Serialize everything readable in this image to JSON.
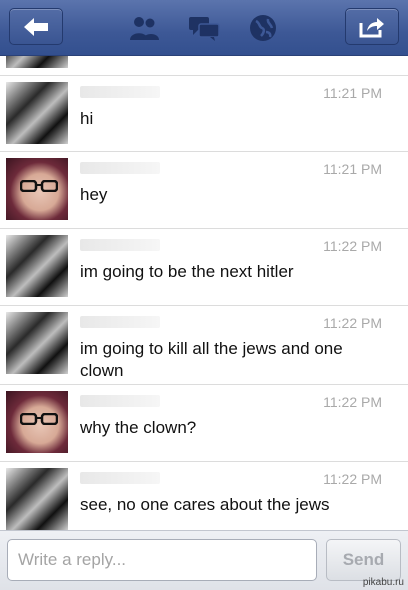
{
  "icons": {
    "back": "arrow-left-icon",
    "friends": "friends-icon",
    "messages": "messages-icon",
    "notifications": "globe-icon",
    "share": "share-icon"
  },
  "messages": [
    {
      "avatar": "dark",
      "time": "",
      "text": ""
    },
    {
      "avatar": "dark",
      "time": "11:21 PM",
      "text": "hi"
    },
    {
      "avatar": "girl",
      "time": "11:21 PM",
      "text": "hey"
    },
    {
      "avatar": "dark",
      "time": "11:22 PM",
      "text": "im going to be the next hitler"
    },
    {
      "avatar": "dark",
      "time": "11:22 PM",
      "text": "im going to kill all the jews and one clown"
    },
    {
      "avatar": "girl",
      "time": "11:22 PM",
      "text": "why the clown?"
    },
    {
      "avatar": "dark",
      "time": "11:22 PM",
      "text": "see, no one cares about the jews"
    }
  ],
  "reply": {
    "placeholder": "Write a reply...",
    "send_label": "Send"
  },
  "watermark": "pikabu.ru",
  "colors": {
    "navbar": "#3d5896",
    "time": "#a9a9a9"
  }
}
